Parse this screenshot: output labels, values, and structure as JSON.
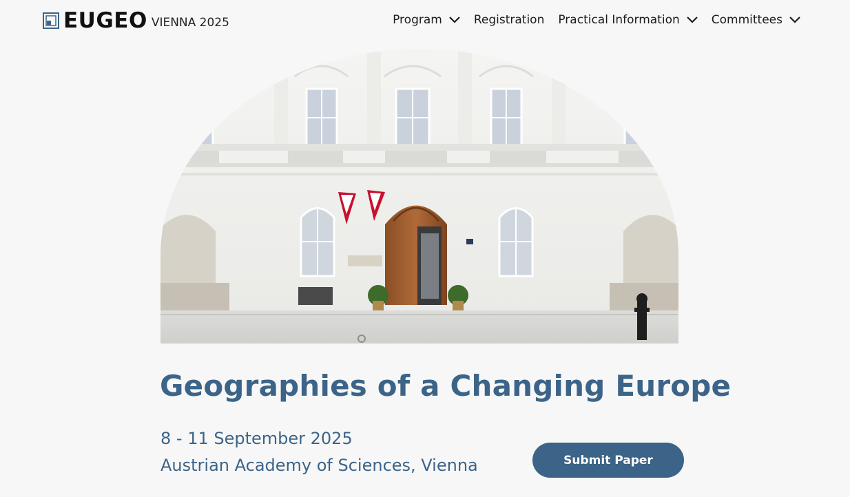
{
  "header": {
    "logo_word": "EUGEO",
    "logo_sub": "VIENNA 2025",
    "nav": [
      {
        "label": "Program",
        "has_dropdown": true
      },
      {
        "label": "Registration",
        "has_dropdown": false
      },
      {
        "label": "Practical Information",
        "has_dropdown": true
      },
      {
        "label": "Committees",
        "has_dropdown": true
      }
    ]
  },
  "hero": {
    "headline": "Geographies of a Changing Europe",
    "date": "8 - 11 September 2025",
    "venue": "Austrian Academy of Sciences, Vienna",
    "cta_label": "Submit Paper"
  },
  "colors": {
    "accent": "#3c6488",
    "background": "#f7f7f7",
    "text": "#1c1c1c"
  },
  "icons": {
    "logo": "square-logo-icon",
    "dropdown": "chevron-down-icon"
  }
}
